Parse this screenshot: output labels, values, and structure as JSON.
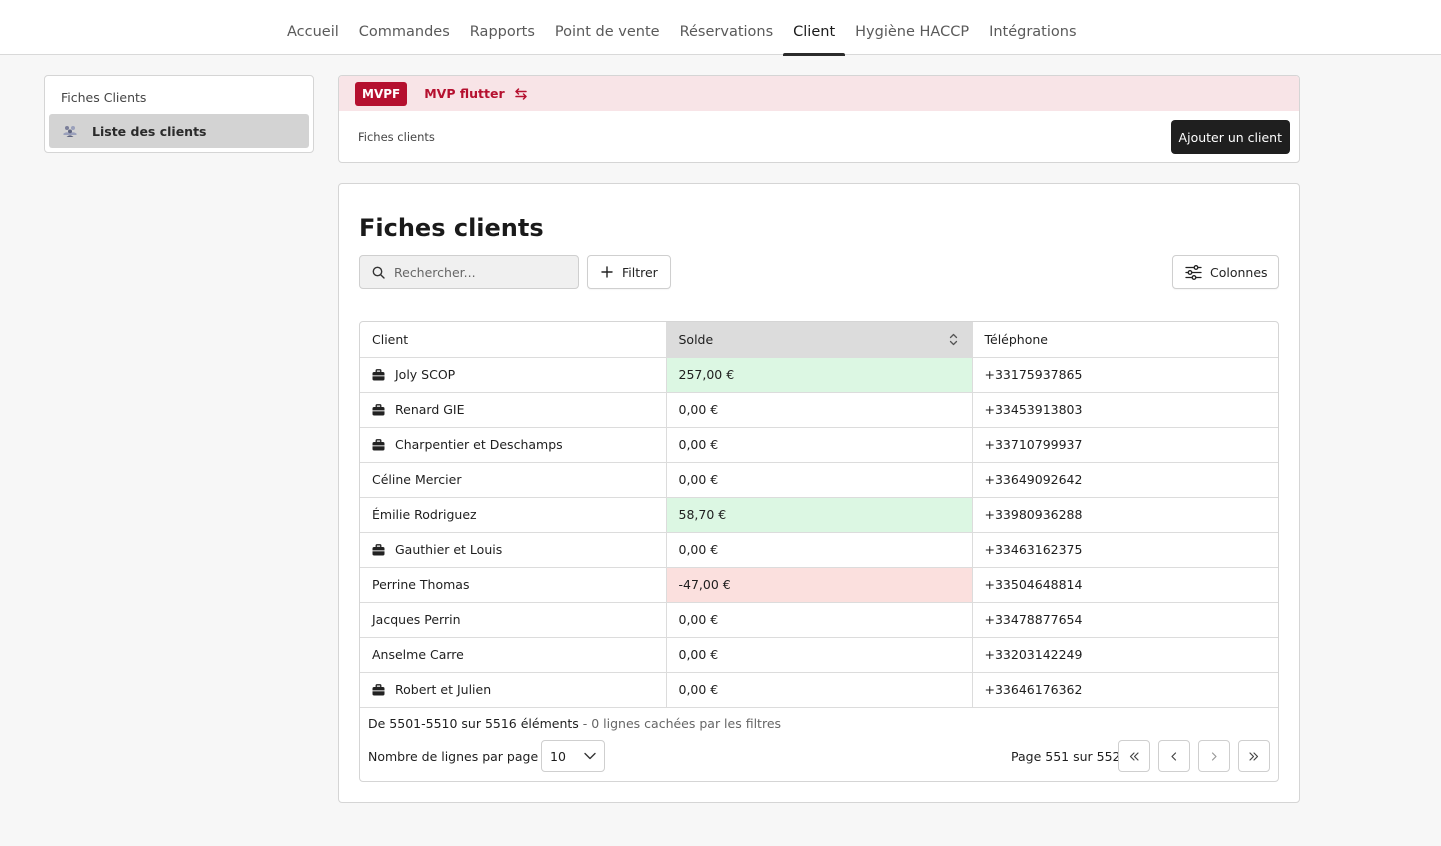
{
  "nav": {
    "items": [
      {
        "label": "Accueil"
      },
      {
        "label": "Commandes"
      },
      {
        "label": "Rapports"
      },
      {
        "label": "Point de vente"
      },
      {
        "label": "Réservations"
      },
      {
        "label": "Client"
      },
      {
        "label": "Hygiène HACCP"
      },
      {
        "label": "Intégrations"
      }
    ],
    "active": "Client"
  },
  "sidebar": {
    "title": "Fiches Clients",
    "items": [
      {
        "label": "Liste des clients",
        "icon": "users-icon"
      }
    ]
  },
  "org": {
    "badge": "MVPF",
    "name": "MVP flutter",
    "accent_color": "#b5102f",
    "background_color": "#f8e4e7"
  },
  "header": {
    "breadcrumb": "Fiches clients",
    "add_button": "Ajouter un client"
  },
  "main": {
    "title": "Fiches clients",
    "search_placeholder": "Rechercher...",
    "filter_label": "Filtrer",
    "columns_label": "Colonnes"
  },
  "table": {
    "columns": [
      "Client",
      "Solde",
      "Téléphone"
    ],
    "rows": [
      {
        "client": "Joly SCOP",
        "business": true,
        "solde": "257,00 €",
        "status": "positive",
        "phone": "+33175937865"
      },
      {
        "client": "Renard GIE",
        "business": true,
        "solde": "0,00 €",
        "status": "zero",
        "phone": "+33453913803"
      },
      {
        "client": "Charpentier et Deschamps",
        "business": true,
        "solde": "0,00 €",
        "status": "zero",
        "phone": "+33710799937"
      },
      {
        "client": "Céline Mercier",
        "business": false,
        "solde": "0,00 €",
        "status": "zero",
        "phone": "+33649092642"
      },
      {
        "client": "Émilie Rodriguez",
        "business": false,
        "solde": "58,70 €",
        "status": "positive",
        "phone": "+33980936288"
      },
      {
        "client": "Gauthier et Louis",
        "business": true,
        "solde": "0,00 €",
        "status": "zero",
        "phone": "+33463162375"
      },
      {
        "client": "Perrine Thomas",
        "business": false,
        "solde": "-47,00 €",
        "status": "negative",
        "phone": "+33504648814"
      },
      {
        "client": "Jacques Perrin",
        "business": false,
        "solde": "0,00 €",
        "status": "zero",
        "phone": "+33478877654"
      },
      {
        "client": "Anselme Carre",
        "business": false,
        "solde": "0,00 €",
        "status": "zero",
        "phone": "+33203142249"
      },
      {
        "client": "Robert et Julien",
        "business": true,
        "solde": "0,00 €",
        "status": "zero",
        "phone": "+33646176362"
      }
    ]
  },
  "footer": {
    "range": "De 5501-5510 sur 5516 éléments",
    "hidden_note": " - 0 lignes cachées par les filtres",
    "rows_per_page_label": "Nombre de lignes par page",
    "rows_per_page_value": "10",
    "page_info": "Page 551 sur 552"
  },
  "colors": {
    "positive_bg": "#dcf7e3",
    "negative_bg": "#fbe0de",
    "sorted_header_bg": "#dcdcdc",
    "primary_button": "#1f1f1f"
  }
}
